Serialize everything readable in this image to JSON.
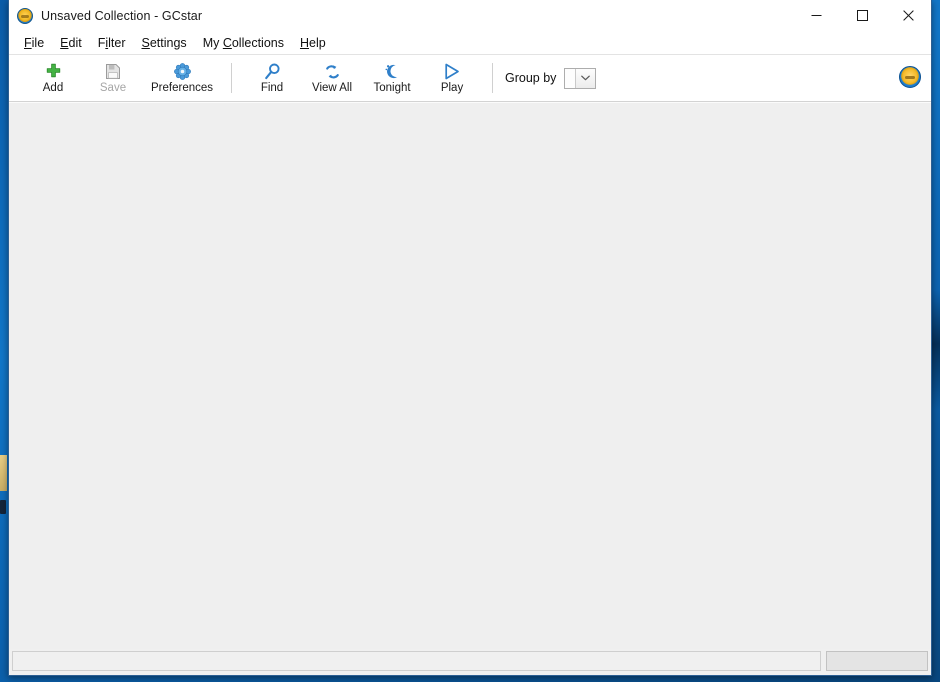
{
  "window": {
    "title": "Unsaved Collection - GCstar",
    "app_icon": "gcstar-logo-icon",
    "controls": {
      "minimize_label": "Minimize",
      "maximize_label": "Maximize",
      "close_label": "Close"
    }
  },
  "menubar": {
    "items": [
      {
        "label": "File",
        "mnemonic_index": 0
      },
      {
        "label": "Edit",
        "mnemonic_index": 0
      },
      {
        "label": "Filter",
        "mnemonic_index": 1
      },
      {
        "label": "Settings",
        "mnemonic_index": 0
      },
      {
        "label": "My Collections",
        "mnemonic_index": 3
      },
      {
        "label": "Help",
        "mnemonic_index": 0
      }
    ]
  },
  "toolbar": {
    "buttons": [
      {
        "label": "Add",
        "icon": "plus-icon",
        "enabled": true,
        "color": "#3faf3f"
      },
      {
        "label": "Save",
        "icon": "floppy-disk-icon",
        "enabled": false,
        "color": "#9a9a9a"
      },
      {
        "label": "Preferences",
        "icon": "gear-icon",
        "enabled": true,
        "color": "#3c8fd6"
      },
      {
        "label": "Find",
        "icon": "magnifier-icon",
        "enabled": true,
        "color": "#2b7fcc"
      },
      {
        "label": "View All",
        "icon": "refresh-arrows-icon",
        "enabled": true,
        "color": "#2b7fcc"
      },
      {
        "label": "Tonight",
        "icon": "crescent-moon-icon",
        "enabled": true,
        "color": "#2b7fcc"
      },
      {
        "label": "Play",
        "icon": "play-triangle-icon",
        "enabled": true,
        "color": "#2b7fcc"
      }
    ],
    "group_by": {
      "label": "Group by",
      "value": "",
      "placeholder": "",
      "options": []
    },
    "right_icon": "gcstar-logo-icon"
  },
  "content": {
    "items": [],
    "empty_text": ""
  },
  "statusbar": {
    "main_text": "",
    "side_text": "",
    "resize_grip": "resize-grip-icon"
  },
  "colors": {
    "accent_blue": "#2b7fcc",
    "add_green": "#3faf3f",
    "window_border": "#2c5f93",
    "content_bg": "#efefef",
    "chrome_bg": "#f0f0f0",
    "desktop_blue": "#0f6cbd"
  }
}
